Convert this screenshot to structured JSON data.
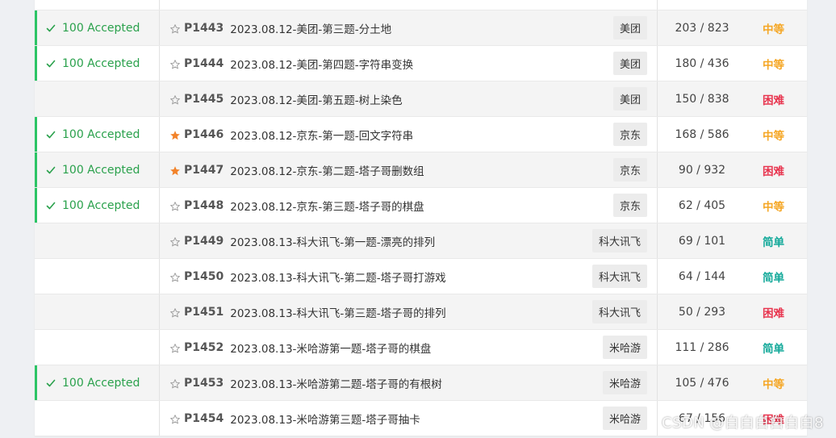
{
  "status_accepted": "100 Accepted",
  "colors": {
    "accepted": "#2aa14c",
    "accepted_bar": "#2bc465",
    "star_filled": "#f2832b",
    "star_outline": "#9b9b9b",
    "medium": "#f5a623",
    "hard": "#e8354f",
    "easy": "#14a99a"
  },
  "rows": [
    {
      "id": "",
      "title": "",
      "tag": "",
      "count": "",
      "difficulty": "",
      "level": "",
      "accepted": false,
      "starred": false,
      "partial": true
    },
    {
      "id": "P1443",
      "title": "2023.08.12-美团-第三题-分土地",
      "tag": "美团",
      "count": "203 / 823",
      "difficulty": "中等",
      "level": "medium",
      "accepted": true,
      "starred": false
    },
    {
      "id": "P1444",
      "title": "2023.08.12-美团-第四题-字符串变换",
      "tag": "美团",
      "count": "180 / 436",
      "difficulty": "中等",
      "level": "medium",
      "accepted": true,
      "starred": false
    },
    {
      "id": "P1445",
      "title": "2023.08.12-美团-第五题-树上染色",
      "tag": "美团",
      "count": "150 / 838",
      "difficulty": "困难",
      "level": "hard",
      "accepted": false,
      "starred": false
    },
    {
      "id": "P1446",
      "title": "2023.08.12-京东-第一题-回文字符串",
      "tag": "京东",
      "count": "168 / 586",
      "difficulty": "中等",
      "level": "medium",
      "accepted": true,
      "starred": true
    },
    {
      "id": "P1447",
      "title": "2023.08.12-京东-第二题-塔子哥删数组",
      "tag": "京东",
      "count": "90 / 932",
      "difficulty": "困难",
      "level": "hard",
      "accepted": true,
      "starred": true
    },
    {
      "id": "P1448",
      "title": "2023.08.12-京东-第三题-塔子哥的棋盘",
      "tag": "京东",
      "count": "62 / 405",
      "difficulty": "中等",
      "level": "medium",
      "accepted": true,
      "starred": false
    },
    {
      "id": "P1449",
      "title": "2023.08.13-科大讯飞-第一题-漂亮的排列",
      "tag": "科大讯飞",
      "count": "69 / 101",
      "difficulty": "简单",
      "level": "easy",
      "accepted": false,
      "starred": false
    },
    {
      "id": "P1450",
      "title": "2023.08.13-科大讯飞-第二题-塔子哥打游戏",
      "tag": "科大讯飞",
      "count": "64 / 144",
      "difficulty": "简单",
      "level": "easy",
      "accepted": false,
      "starred": false
    },
    {
      "id": "P1451",
      "title": "2023.08.13-科大讯飞-第三题-塔子哥的排列",
      "tag": "科大讯飞",
      "count": "50 / 293",
      "difficulty": "困难",
      "level": "hard",
      "accepted": false,
      "starred": false
    },
    {
      "id": "P1452",
      "title": "2023.08.13-米哈游第一题-塔子哥的棋盘",
      "tag": "米哈游",
      "count": "111 / 286",
      "difficulty": "简单",
      "level": "easy",
      "accepted": false,
      "starred": false
    },
    {
      "id": "P1453",
      "title": "2023.08.13-米哈游第二题-塔子哥的有根树",
      "tag": "米哈游",
      "count": "105 / 476",
      "difficulty": "中等",
      "level": "medium",
      "accepted": true,
      "starred": false
    },
    {
      "id": "P1454",
      "title": "2023.08.13-米哈游第三题-塔子哥抽卡",
      "tag": "米哈游",
      "count": "67 / 156",
      "difficulty": "困难",
      "level": "hard",
      "accepted": false,
      "starred": false
    }
  ],
  "watermark": "CSDN @白白白白白白8"
}
